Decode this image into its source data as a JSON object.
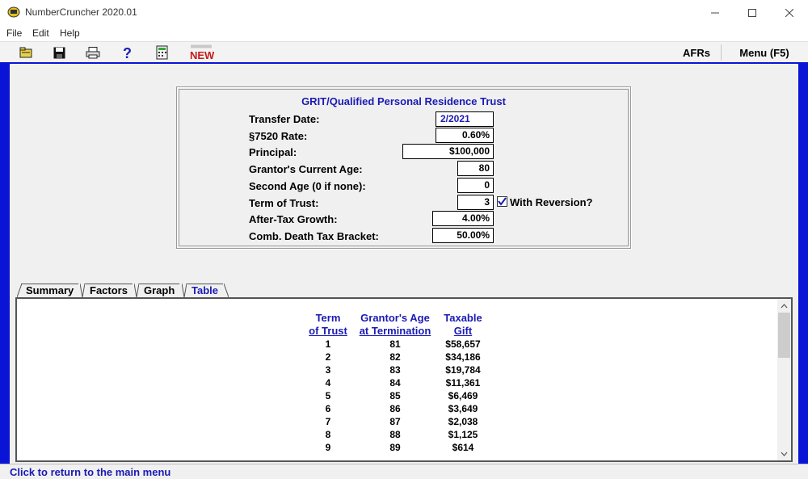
{
  "window": {
    "title": "NumberCruncher 2020.01"
  },
  "menu": [
    "File",
    "Edit",
    "Help"
  ],
  "toolbar": {
    "news_label": "NEWS",
    "afrs_label": "AFRs",
    "menu_label": "Menu (F5)"
  },
  "panel": {
    "title": "GRIT/Qualified Personal Residence Trust",
    "fields": {
      "transfer_date": {
        "label": "Transfer Date:",
        "value": "2/2021"
      },
      "rate_7520": {
        "label": "§7520 Rate:",
        "value": "0.60%"
      },
      "principal": {
        "label": "Principal:",
        "value": "$100,000"
      },
      "grantor_age": {
        "label": "Grantor's Current Age:",
        "value": "80"
      },
      "second_age": {
        "label": "Second Age (0 if none):",
        "value": "0"
      },
      "term": {
        "label": "Term of Trust:",
        "value": "3"
      },
      "growth": {
        "label": "After-Tax Growth:",
        "value": "4.00%"
      },
      "death_tax": {
        "label": "Comb. Death Tax Bracket:",
        "value": "50.00%"
      }
    },
    "reversion": {
      "label": "With Reversion?",
      "checked": true
    }
  },
  "tabs": [
    {
      "label": "Summary",
      "active": false
    },
    {
      "label": "Factors",
      "active": false
    },
    {
      "label": "Graph",
      "active": false
    },
    {
      "label": "Table",
      "active": true
    }
  ],
  "table": {
    "headers": [
      {
        "line1": "Term",
        "line2": "of Trust"
      },
      {
        "line1": "Grantor's Age",
        "line2": "at Termination"
      },
      {
        "line1": "Taxable",
        "line2": "Gift"
      }
    ],
    "rows": [
      [
        "1",
        "81",
        "$58,657"
      ],
      [
        "2",
        "82",
        "$34,186"
      ],
      [
        "3",
        "83",
        "$19,784"
      ],
      [
        "4",
        "84",
        "$11,361"
      ],
      [
        "5",
        "85",
        "$6,469"
      ],
      [
        "6",
        "86",
        "$3,649"
      ],
      [
        "7",
        "87",
        "$2,038"
      ],
      [
        "8",
        "88",
        "$1,125"
      ],
      [
        "9",
        "89",
        "$614"
      ]
    ]
  },
  "status": {
    "text": "Click to return to the main menu"
  },
  "colors": {
    "frame": "#0a14d6",
    "accent_text": "#1a1ab4"
  }
}
